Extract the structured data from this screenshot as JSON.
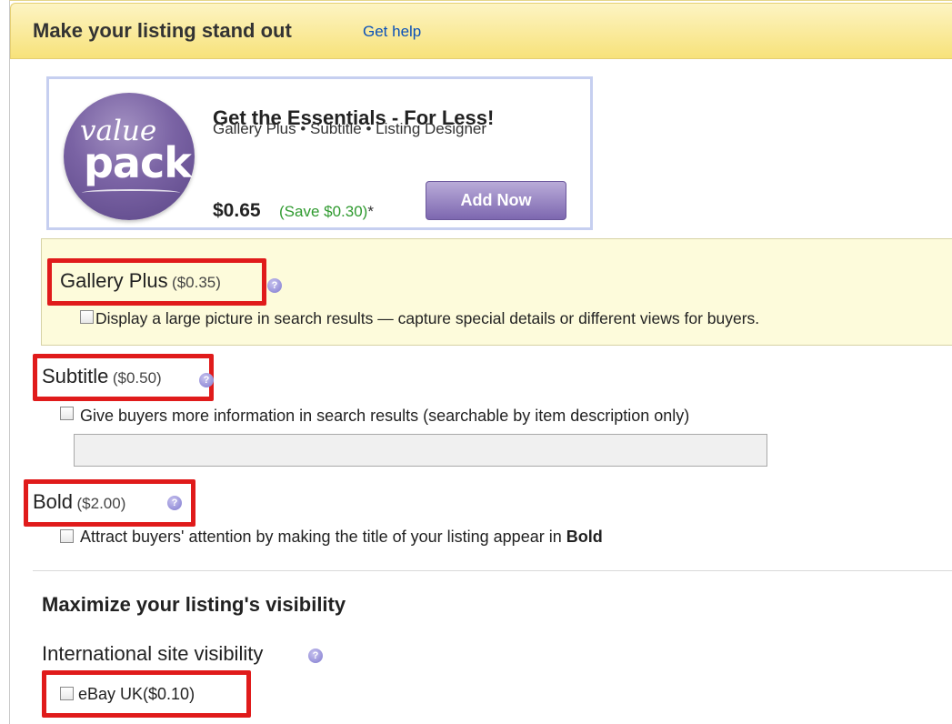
{
  "header": {
    "title": "Make your listing stand out",
    "help_link": "Get help"
  },
  "promo": {
    "logo_text_1": "value",
    "logo_text_2": "pack",
    "title": "Get the Essentials - For Less!",
    "items": "Gallery Plus • Subtitle • Listing Designer",
    "price": "$0.65",
    "save": "(Save $0.30)",
    "save_mark": "*",
    "button_label": "Add Now"
  },
  "options": {
    "gallery_plus": {
      "label": "Gallery Plus",
      "price": "($0.35)",
      "description": "Display a large picture in search results — capture special details or different views for buyers."
    },
    "subtitle": {
      "label": "Subtitle",
      "price": "($0.50)",
      "description": "Give buyers more information in search results (searchable by item description only)",
      "input_value": ""
    },
    "bold": {
      "label": "Bold",
      "price": "($2.00)",
      "description_prefix": "Attract buyers' attention by making the title of your listing appear in ",
      "description_bold": "Bold"
    }
  },
  "visibility": {
    "section_title": "Maximize your listing's visibility",
    "international_label": "International site visibility",
    "ebay_uk_label": "eBay UK($0.10)"
  },
  "icons": {
    "help": "?"
  },
  "colors": {
    "link": "#0b51b8",
    "highlight": "#e01b1b",
    "save_green": "#2f9a2f",
    "button_purple": "#7d67b0",
    "header_yellow": "#f7e27a"
  }
}
